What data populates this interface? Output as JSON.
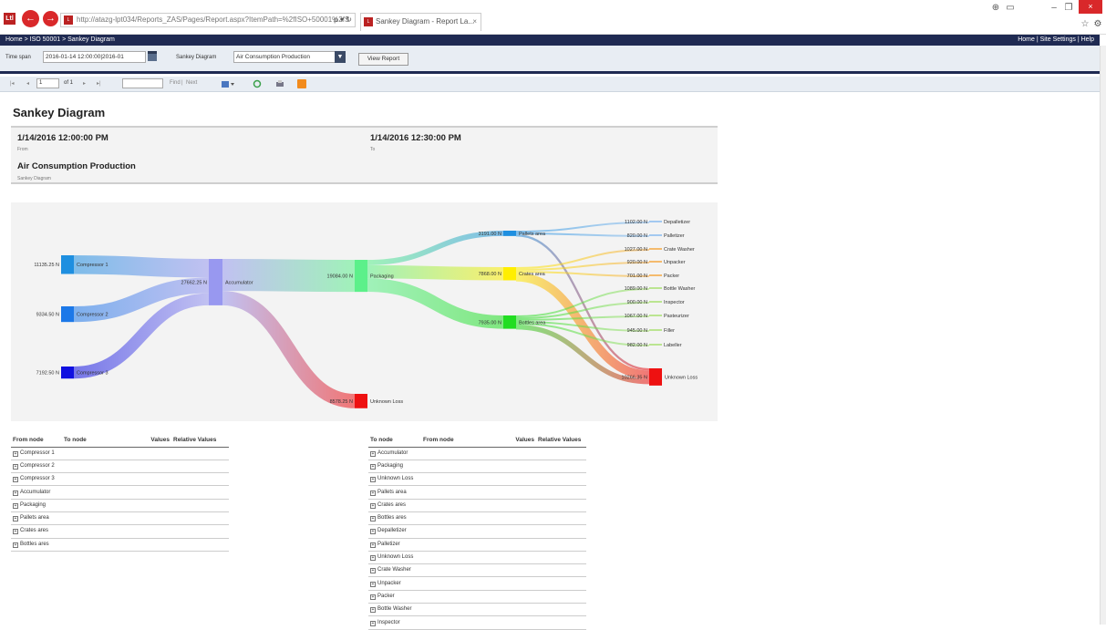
{
  "browser": {
    "url": "http://atazg-lpt034/Reports_ZAS/Pages/Report.aspx?ItemPath=%2fISO+50001%2fS",
    "url_controls": "ρ ▾ ↻",
    "tab_title": "Sankey Diagram - Report La...",
    "tab_close": "×",
    "back_glyph": "←",
    "forward_glyph": "→",
    "logo_text": "Ltl",
    "window_controls": [
      "–",
      "❐",
      "×"
    ],
    "top_icons": [
      "⊕",
      "▭",
      "☆",
      "⚙"
    ]
  },
  "menubar": {
    "breadcrumb": "Home  >  ISO 50001  >  Sankey Diagram",
    "links": "Home  |  Site Settings  |  Help"
  },
  "params": {
    "timespan_label": "Time span",
    "timespan_value": "2016-01-14 12:00:00|2016-01",
    "sankey_label": "Sankey Diagram",
    "sankey_value": "Air Consumption Production",
    "view_report": "View Report"
  },
  "toolbar": {
    "first": "|◂",
    "prev": "◂",
    "page": "1",
    "of": "of 1",
    "next": "▸",
    "last": "▸|",
    "find": "Find",
    "sep": "|",
    "next_label": "Next"
  },
  "report": {
    "title": "Sankey Diagram",
    "from_value": "1/14/2016 12:00:00 PM",
    "from_label": "From",
    "to_value": "1/14/2016 12:30:00 PM",
    "to_label": "To",
    "diagram_value": "Air Consumption Production",
    "diagram_label": "Sankey Diagram"
  },
  "sankey": {
    "nodes": [
      {
        "name": "Compressor 1",
        "value": "11135.25 N",
        "color": "#1e8fe0"
      },
      {
        "name": "Compressor 2",
        "value": "9334.50 N",
        "color": "#1c78e8"
      },
      {
        "name": "Compressor 3",
        "value": "7192.50 N",
        "color": "#1010e0"
      },
      {
        "name": "Accumulator",
        "value": "27662.25 N",
        "color": "#9898f0"
      },
      {
        "name": "Packaging",
        "value": "19084.00 N",
        "color": "#5cf08a"
      },
      {
        "name": "Unknown Loss",
        "value": "8578.25 N",
        "color": "#ee1111"
      },
      {
        "name": "Pallets area",
        "value": "3191.00 N",
        "color": "#1e8fe0"
      },
      {
        "name": "Crates area",
        "value": "7868.00 N",
        "color": "#ffee00"
      },
      {
        "name": "Bottles area",
        "value": "7935.00 N",
        "color": "#22dd22"
      },
      {
        "name": "Depalletizer",
        "value": "1102.00 N",
        "color": "#88bbee"
      },
      {
        "name": "Palletizer",
        "value": "820.00 N",
        "color": "#88bbee"
      },
      {
        "name": "Crate Washer",
        "value": "1027.00 N",
        "color": "#f4a640"
      },
      {
        "name": "Unpacker",
        "value": "920.00 N",
        "color": "#f4a640"
      },
      {
        "name": "Packer",
        "value": "701.00 N",
        "color": "#f4a640"
      },
      {
        "name": "Bottle Washer",
        "value": "1089.00 N",
        "color": "#a8e070"
      },
      {
        "name": "Inspector",
        "value": "900.00 N",
        "color": "#a8e070"
      },
      {
        "name": "Pasteurizer",
        "value": "1067.00 N",
        "color": "#a8e070"
      },
      {
        "name": "Filler",
        "value": "945.00 N",
        "color": "#a8e070"
      },
      {
        "name": "Labeller",
        "value": "982.00 N",
        "color": "#a8e070"
      },
      {
        "name": "Unknown Loss",
        "value": "10266.35 N",
        "color": "#ee1111"
      }
    ],
    "links": [
      {
        "source": 0,
        "target": 3,
        "value": 11135.25
      },
      {
        "source": 1,
        "target": 3,
        "value": 9334.5
      },
      {
        "source": 2,
        "target": 3,
        "value": 7192.5
      },
      {
        "source": 3,
        "target": 4,
        "value": 19084
      },
      {
        "source": 3,
        "target": 5,
        "value": 8578.25
      },
      {
        "source": 4,
        "target": 6,
        "value": 3191
      },
      {
        "source": 4,
        "target": 7,
        "value": 7868
      },
      {
        "source": 4,
        "target": 8,
        "value": 7935
      },
      {
        "source": 6,
        "target": 9,
        "value": 1102
      },
      {
        "source": 6,
        "target": 10,
        "value": 820
      },
      {
        "source": 6,
        "target": 19,
        "value": 1269
      },
      {
        "source": 7,
        "target": 11,
        "value": 1027
      },
      {
        "source": 7,
        "target": 12,
        "value": 920
      },
      {
        "source": 7,
        "target": 13,
        "value": 701
      },
      {
        "source": 7,
        "target": 19,
        "value": 5220
      },
      {
        "source": 8,
        "target": 14,
        "value": 1089
      },
      {
        "source": 8,
        "target": 15,
        "value": 900
      },
      {
        "source": 8,
        "target": 16,
        "value": 1067
      },
      {
        "source": 8,
        "target": 17,
        "value": 945
      },
      {
        "source": 8,
        "target": 18,
        "value": 982
      },
      {
        "source": 8,
        "target": 19,
        "value": 2952
      }
    ]
  },
  "left_table": {
    "headers": [
      "From node",
      "To node",
      "Values",
      "Relative Values"
    ],
    "rows": [
      "Compressor 1",
      "Compressor 2",
      "Compressor 3",
      "Accumulator",
      "Packaging",
      "Pallets area",
      "Crates ares",
      "Bottles ares"
    ]
  },
  "right_table": {
    "headers": [
      "To node",
      "From node",
      "Values",
      "Relative Values"
    ],
    "rows": [
      "Accumulator",
      "Packaging",
      "Unknown Loss",
      "Pallets area",
      "Crates ares",
      "Bottles ares",
      "Depalletizer",
      "Palletizer",
      "Unknown Loss",
      "Crate Washer",
      "Unpacker",
      "Packer",
      "Bottle Washer",
      "Inspector"
    ]
  },
  "expand_glyph": "+"
}
